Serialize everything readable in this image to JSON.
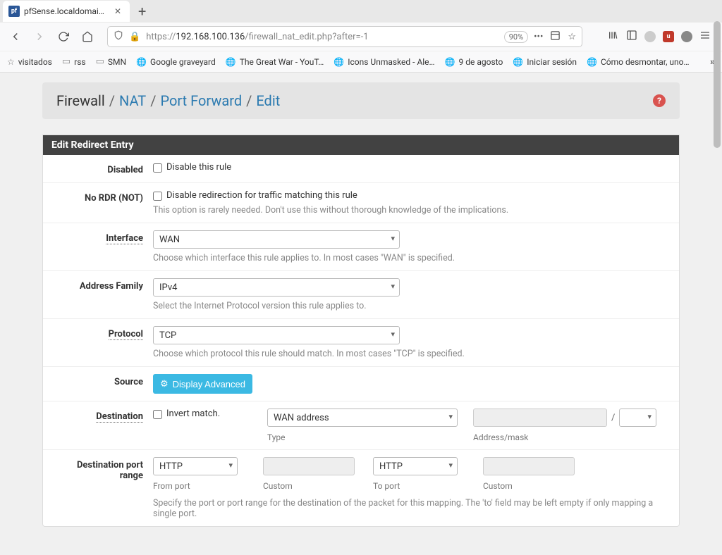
{
  "tab": {
    "title": "pfSense.localdomain.net - F"
  },
  "url": {
    "prefix": "https://",
    "host": "192.168.100.136",
    "path": "/firewall_nat_edit.php?after=-1",
    "zoom": "90%"
  },
  "bookmarks": [
    {
      "icon": "star",
      "label": "visitados"
    },
    {
      "icon": "folder",
      "label": "rss"
    },
    {
      "icon": "folder",
      "label": "SMN"
    },
    {
      "icon": "globe",
      "label": "Google graveyard"
    },
    {
      "icon": "globe",
      "label": "The Great War - YouT…"
    },
    {
      "icon": "globe",
      "label": "Icons Unmasked - Ale…"
    },
    {
      "icon": "globe",
      "label": "9 de agosto"
    },
    {
      "icon": "globe",
      "label": "Iniciar sesión"
    },
    {
      "icon": "globe",
      "label": "Cómo desmontar, uno…"
    }
  ],
  "breadcrumb": [
    "Firewall",
    "NAT",
    "Port Forward",
    "Edit"
  ],
  "panel_title": "Edit Redirect Entry",
  "form": {
    "disabled": {
      "label": "Disabled",
      "check": "Disable this rule"
    },
    "nordr": {
      "label": "No RDR (NOT)",
      "check": "Disable redirection for traffic matching this rule",
      "help": "This option is rarely needed. Don't use this without thorough knowledge of the implications."
    },
    "interface": {
      "label": "Interface",
      "value": "WAN",
      "help": "Choose which interface this rule applies to. In most cases \"WAN\" is specified."
    },
    "af": {
      "label": "Address Family",
      "value": "IPv4",
      "help": "Select the Internet Protocol version this rule applies to."
    },
    "protocol": {
      "label": "Protocol",
      "value": "TCP",
      "help": "Choose which protocol this rule should match. In most cases \"TCP\" is specified."
    },
    "source": {
      "label": "Source",
      "button": "Display Advanced"
    },
    "dest": {
      "label": "Destination",
      "invert": "Invert match.",
      "type_value": "WAN address",
      "type_label": "Type",
      "mask_label": "Address/mask",
      "slash": "/"
    },
    "dport": {
      "label": "Destination port range",
      "from_value": "HTTP",
      "from_label": "From port",
      "custom_label": "Custom",
      "to_value": "HTTP",
      "to_label": "To port",
      "help": "Specify the port or port range for the destination of the packet for this mapping. The 'to' field may be left empty if only mapping a single port."
    }
  }
}
